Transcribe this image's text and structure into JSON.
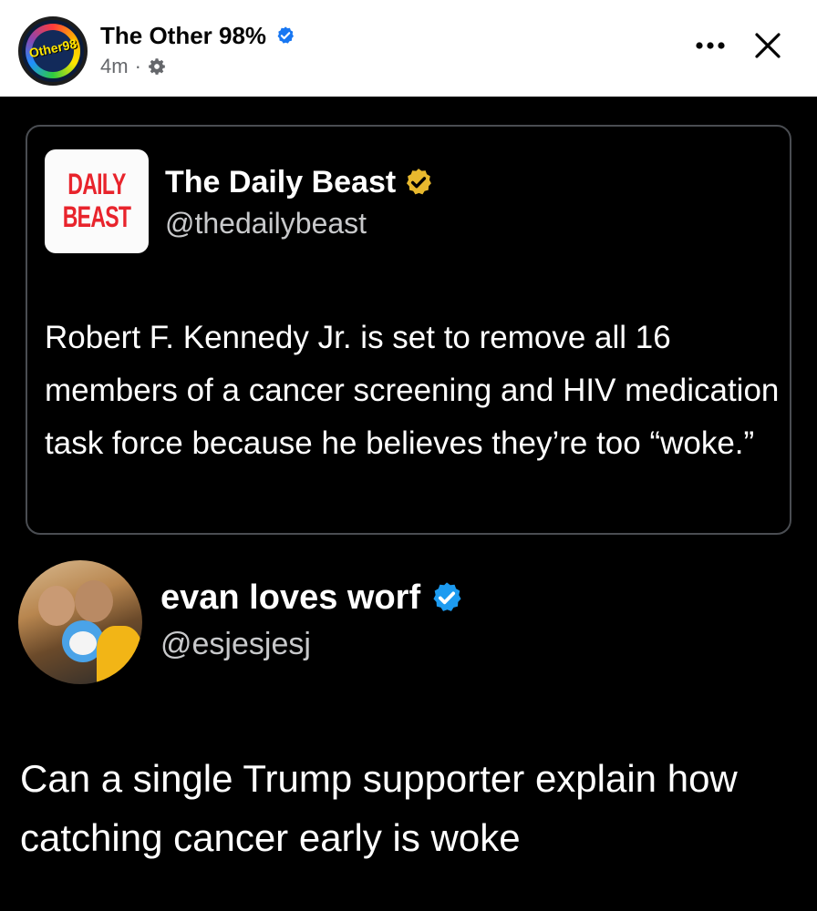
{
  "post_header": {
    "page_name": "The Other 98%",
    "timestamp": "4m",
    "separator": "·",
    "avatar_text": "Other98",
    "icons": {
      "verified": "verified-badge-icon",
      "audience": "gear-icon",
      "more": "more-options-icon",
      "close": "close-icon"
    }
  },
  "quoted_tweet": {
    "logo_lines": [
      "DAILY",
      "BEAST"
    ],
    "display_name": "The Daily Beast",
    "handle": "@thedailybeast",
    "badge": "gold-verified-badge-icon",
    "text": "Robert F. Kennedy Jr. is set to remove all 16 members of a cancer screening and HIV medication task force because he believes they’re too “woke.”"
  },
  "tweet": {
    "display_name": "evan loves worf",
    "handle": "@esjesjesj",
    "badge": "blue-verified-badge-icon",
    "text": "Can a single Trump supporter explain how catching cancer early is woke"
  },
  "colors": {
    "facebook_verified": "#1877f2",
    "x_gold_badge": "#e8b92e",
    "x_blue_badge": "#1d9bf0",
    "daily_beast_red": "#e8242c",
    "background": "#000000"
  }
}
